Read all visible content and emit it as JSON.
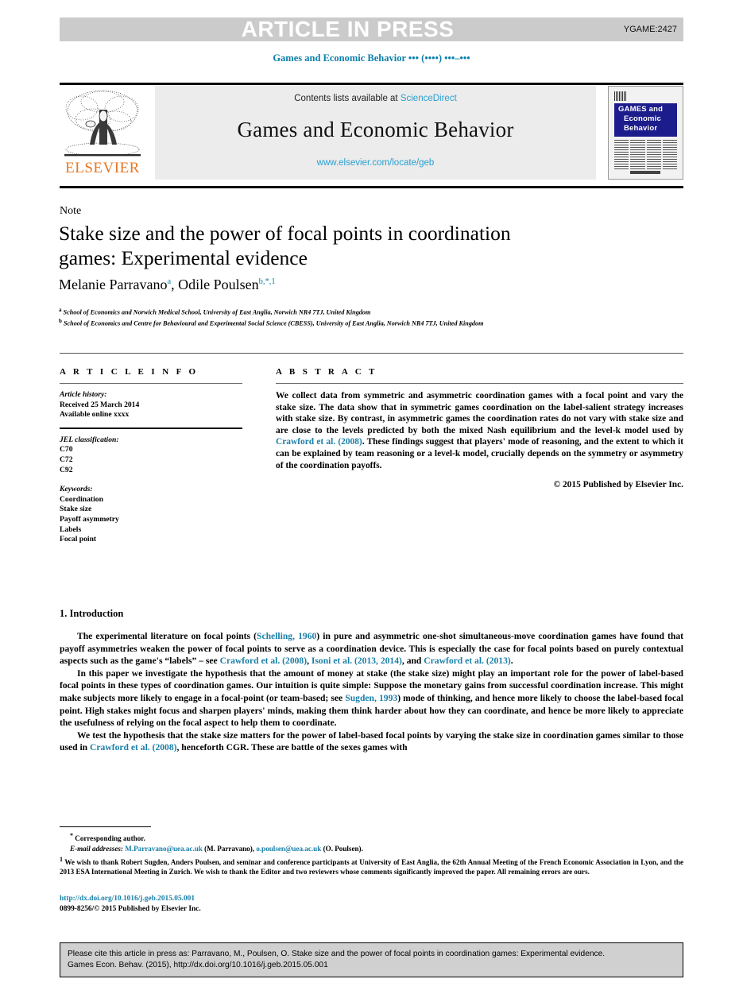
{
  "header": {
    "article_in_press": "ARTICLE IN PRESS",
    "article_code": "YGAME:2427",
    "running_head": "Games and Economic Behavior ••• (••••) •••–•••"
  },
  "masthead": {
    "contents_prefix": "Contents lists available at ",
    "sciencedirect": "ScienceDirect",
    "journal_title": "Games and Economic Behavior",
    "journal_url": "www.elsevier.com/locate/geb",
    "publisher": "ELSEVIER",
    "cover": {
      "line1": "GAMES and",
      "line2": "Economic",
      "line3": "Behavior"
    }
  },
  "article": {
    "type_label": "Note",
    "title": "Stake size and the power of focal points in coordination games: Experimental evidence",
    "authors_plain": "Melanie Parravano",
    "author1": "Melanie Parravano",
    "author1_sup": "a",
    "author2": "Odile Poulsen",
    "author2_sup": "b,*,1",
    "affiliation_a_sup": "a",
    "affiliation_a": "School of Economics and Norwich Medical School, University of East Anglia, Norwich NR4 7TJ, United Kingdom",
    "affiliation_b_sup": "b",
    "affiliation_b": "School of Economics and Centre for Behavioural and Experimental Social Science (CBESS), University of East Anglia, Norwich NR4 7TJ, United Kingdom"
  },
  "info": {
    "heading": "A R T I C L E    I N F O",
    "history_label": "Article history:",
    "received": "Received 25 March 2014",
    "available": "Available online xxxx",
    "jel_label": "JEL classification:",
    "jel_codes": [
      "C70",
      "C72",
      "C92"
    ],
    "keywords_label": "Keywords:",
    "keywords": [
      "Coordination",
      "Stake size",
      "Payoff asymmetry",
      "Labels",
      "Focal point"
    ]
  },
  "abstract": {
    "heading": "A B S T R A C T",
    "part1": "We collect data from symmetric and asymmetric coordination games with a focal point and vary the stake size. The data show that in symmetric games coordination on the label-salient strategy increases with stake size. By contrast, in asymmetric games the coordination rates do not vary with stake size and are close to the levels predicted by both the mixed Nash equilibrium and the level-k model used by ",
    "citation1": "Crawford et al. (2008)",
    "part2": ". These findings suggest that players' mode of reasoning, and the extent to which it can be explained by team reasoning or a level-k model, crucially depends on the symmetry or asymmetry of the coordination payoffs.",
    "copyright": "© 2015 Published by Elsevier Inc."
  },
  "introduction": {
    "heading": "1. Introduction",
    "p1_a": "The experimental literature on focal points (",
    "p1_cite1": "Schelling, 1960",
    "p1_b": ") in pure and asymmetric one-shot simultaneous-move coordination games have found that payoff asymmetries weaken the power of focal points to serve as a coordination device. This is especially the case for focal points based on purely contextual aspects such as the game's “labels” – see ",
    "p1_cite2": "Crawford et al. (2008)",
    "p1_c": ", ",
    "p1_cite3": "Isoni et al. (2013, 2014)",
    "p1_d": ", and ",
    "p1_cite4": "Crawford et al. (2013)",
    "p1_e": ".",
    "p2_a": "In this paper we investigate the hypothesis that the amount of money at stake (the stake size) might play an important role for the power of label-based focal points in these types of coordination games. Our intuition is quite simple: Suppose the monetary gains from successful coordination increase. This might make subjects more likely to engage in a focal-point (or team-based; see ",
    "p2_cite1": "Sugden, 1993",
    "p2_b": ") mode of thinking, and hence more likely to choose the label-based focal point. High stakes might focus and sharpen players' minds, making them think harder about how they can coordinate, and hence be more likely to appreciate the usefulness of relying on the focal aspect to help them to coordinate.",
    "p3_a": "We test the hypothesis that the stake size matters for the power of label-based focal points by varying the stake size in coordination games similar to those used in ",
    "p3_cite1": "Crawford et al. (2008)",
    "p3_b": ", henceforth CGR. These are battle of the sexes games with"
  },
  "footnotes": {
    "star_sup": "*",
    "corresponding": "Corresponding author.",
    "email_label": "E-mail addresses:",
    "email1": "M.Parravano@uea.ac.uk",
    "email1_owner": "(M. Parravano),",
    "email2": "o.poulsen@uea.ac.uk",
    "email2_owner": "(O. Poulsen).",
    "note1_sup": "1",
    "note1": "We wish to thank Robert Sugden, Anders Poulsen, and seminar and conference participants at University of East Anglia, the 62th Annual Meeting of the French Economic Association in Lyon, and the 2013 ESA International Meeting in Zurich. We wish to thank the Editor and two reviewers whose comments significantly improved the paper. All remaining errors are ours."
  },
  "imprint": {
    "doi": "http://dx.doi.org/10.1016/j.geb.2015.05.001",
    "issn_line": "0899-8256/© 2015 Published by Elsevier Inc."
  },
  "cite_box": {
    "line1": "Please cite this article in press as: Parravano, M., Poulsen, O. Stake size and the power of focal points in coordination games: Experimental evidence.",
    "line2": "Games Econ. Behav. (2015), http://dx.doi.org/10.1016/j.geb.2015.05.001"
  },
  "colors": {
    "link_blue": "#1a7fa8",
    "sciencedirect_blue": "#2a9fd0",
    "elsevier_orange": "#E87722",
    "banner_gray": "#cbcbcb",
    "masthead_gray": "#ececec",
    "cite_box_gray": "#d0d0d0",
    "cover_blue": "#1c1c8c"
  }
}
